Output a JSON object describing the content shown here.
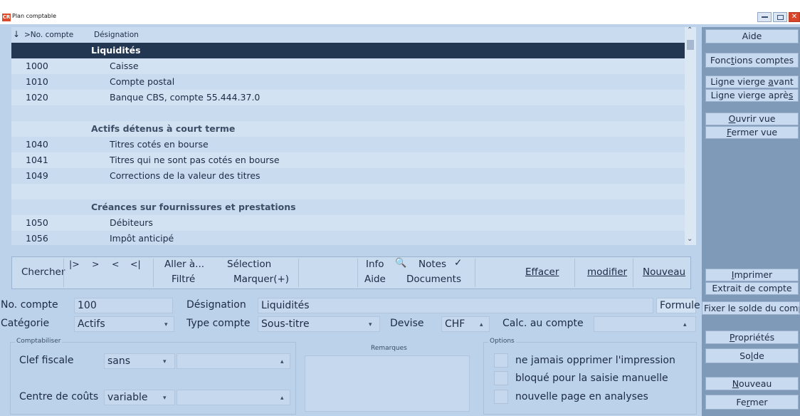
{
  "window": {
    "title": "Plan comptable"
  },
  "grid": {
    "col_sort": "↓",
    "col_number": ">No. compte",
    "col_designation": "Désignation",
    "rows": [
      {
        "number": "",
        "designation": "Liquidités",
        "type": "selected"
      },
      {
        "number": "1000",
        "designation": "Caisse",
        "type": "account"
      },
      {
        "number": "1010",
        "designation": "Compte postal",
        "type": "account"
      },
      {
        "number": "1020",
        "designation": "Banque CBS, compte 55.444.37.0",
        "type": "account"
      },
      {
        "number": "",
        "designation": "",
        "type": "blank"
      },
      {
        "number": "",
        "designation": "Actifs détenus à court terme",
        "type": "subtitle"
      },
      {
        "number": "1040",
        "designation": "Titres cotés en bourse",
        "type": "account"
      },
      {
        "number": "1041",
        "designation": "Titres qui ne sont pas cotés en bourse",
        "type": "account"
      },
      {
        "number": "1049",
        "designation": "Corrections de la valeur des titres",
        "type": "account"
      },
      {
        "number": "",
        "designation": "",
        "type": "blank"
      },
      {
        "number": "",
        "designation": "Créances sur fournissures et prestations",
        "type": "subtitle"
      },
      {
        "number": "1050",
        "designation": "Débiteurs",
        "type": "account"
      },
      {
        "number": "1056",
        "designation": "Impôt anticipé",
        "type": "account"
      }
    ]
  },
  "nav": {
    "search": "Chercher",
    "first": "|>",
    "prev": ">",
    "next": "<",
    "last": "<|",
    "goto": "Aller à...",
    "filtered": "Filtré",
    "selection": "Sélection",
    "mark": "Marquer(+)",
    "info": "Info",
    "notes": "Notes",
    "help": "Aide",
    "documents": "Documents",
    "delete": "Effacer",
    "modify": "modifier",
    "new": "Nouveau"
  },
  "form": {
    "account_no_label": "No. compte",
    "account_no": "100",
    "designation_label": "Désignation",
    "designation": "Liquidités",
    "formula": "Formule",
    "category_label": "Catégorie",
    "category": "Actifs",
    "account_type_label": "Type compte",
    "account_type": "Sous-titre",
    "currency_label": "Devise",
    "currency": "CHF",
    "calc_label": "Calc. au compte",
    "calc": ""
  },
  "book": {
    "group": "Comptabiliser",
    "tax_key_label": "Clef fiscale",
    "tax_key": "sans",
    "cost_center_label": "Centre de coûts",
    "cost_center": "variable"
  },
  "remarks": {
    "group": "Remarques"
  },
  "options": {
    "group": "Options",
    "opt1": "ne jamais opprimer l'impression",
    "opt2": "bloqué pour la saisie manuelle",
    "opt3": "nouvelle page en analyses"
  },
  "side": {
    "help": "Aide",
    "account_functions": "Fonctions comptes",
    "blank_before": "Ligne vierge avant",
    "blank_after": "Ligne vierge après",
    "open_view": "Ouvrir vue",
    "close_view": "Fermer vue",
    "print": "Imprimer",
    "statement": "Extrait de compte",
    "fix_balance": "Fixer le solde du compte",
    "properties": "Propriétés",
    "balance": "Solde",
    "new": "Nouveau",
    "close": "Fermer"
  },
  "colors": {
    "selected_row": "#233652",
    "side_panel": "#7f99b9",
    "background": "#bcd1ea"
  }
}
